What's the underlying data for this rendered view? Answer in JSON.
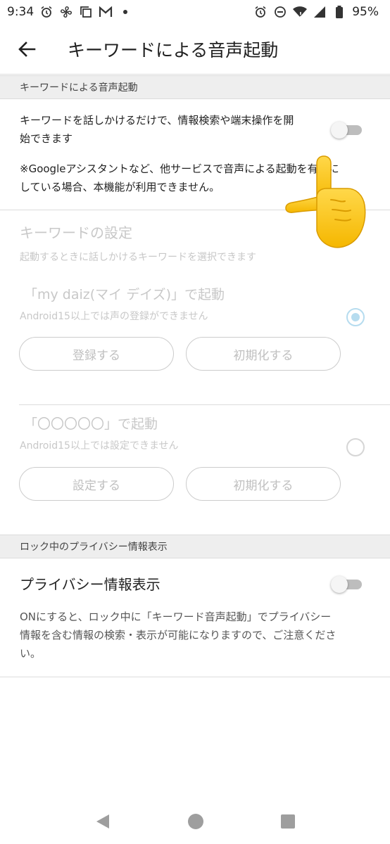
{
  "status_bar": {
    "time": "9:34",
    "battery": "95%",
    "left_icons": [
      "alarm-icon",
      "fan-icon",
      "copy-icon",
      "gmail-icon",
      "dot-icon"
    ],
    "right_icons": [
      "alarm-icon",
      "dnd-icon",
      "wifi-icon",
      "signal-icon",
      "battery-icon"
    ]
  },
  "app_bar": {
    "title": "キーワードによる音声起動"
  },
  "section1": {
    "header": "キーワードによる音声起動",
    "main_text_line1": "キーワードを話しかけるだけで、情報検索や端末操作を開",
    "main_text_line2": "始できます",
    "toggle_on": false,
    "note_line1": "※Googleアシスタントなど、他サービスで音声による起動を有効に",
    "note_line2": "している場合、本機能が利用できません。"
  },
  "keyword_settings": {
    "title": "キーワードの設定",
    "subtitle": "起動するときに話しかけるキーワードを選択できます",
    "option1": {
      "title": "「my daiz(マイ デイズ)」で起動",
      "sub": "Android15以上では声の登録ができません",
      "selected": true,
      "btn_register": "登録する",
      "btn_reset": "初期化する"
    },
    "option2": {
      "title": "「〇〇〇〇〇」で起動",
      "sub": "Android15以上では設定できません",
      "selected": false,
      "btn_set": "設定する",
      "btn_reset": "初期化する"
    }
  },
  "section2": {
    "header": "ロック中のプライバシー情報表示",
    "title": "プライバシー情報表示",
    "toggle_on": false,
    "desc_line1": "ONにすると、ロック中に「キーワード音声起動」でプライバシー",
    "desc_line2": "情報を含む情報の検索・表示が可能になりますので、ご注意くださ",
    "desc_line3": "い。"
  },
  "overlay": {
    "icon": "pointing-hand-emoji"
  },
  "nav_bar": {
    "icons": [
      "back-triangle-icon",
      "home-circle-icon",
      "recents-square-icon"
    ]
  },
  "colors": {
    "accent_disabled": "#b6dcef",
    "disabled_text": "#c8c8c8",
    "section_bg": "#eeeeee"
  }
}
